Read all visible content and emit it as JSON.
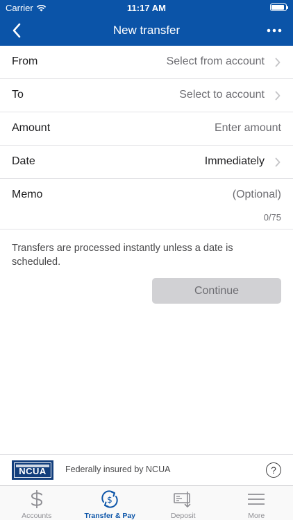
{
  "status_bar": {
    "carrier": "Carrier",
    "time": "11:17 AM",
    "battery_level": 0.9
  },
  "nav": {
    "title": "New transfer",
    "back_icon": "chevron-left-icon",
    "more_icon": "ellipsis-icon"
  },
  "form": {
    "from": {
      "label": "From",
      "value": "Select from account"
    },
    "to": {
      "label": "To",
      "value": "Select to account"
    },
    "amount": {
      "label": "Amount",
      "placeholder": "Enter amount"
    },
    "date": {
      "label": "Date",
      "value": "Immediately"
    },
    "memo": {
      "label": "Memo",
      "placeholder": "(Optional)",
      "counter": "0/75"
    }
  },
  "info_text": "Transfers are processed instantly unless a date is scheduled.",
  "continue_label": "Continue",
  "footer": {
    "logo_text": "NCUA",
    "insured_text": "Federally insured by NCUA",
    "help_label": "?"
  },
  "tabs": [
    {
      "label": "Accounts",
      "icon": "dollar-icon",
      "active": false
    },
    {
      "label": "Transfer & Pay",
      "icon": "transfer-pay-icon",
      "active": true
    },
    {
      "label": "Deposit",
      "icon": "check-deposit-icon",
      "active": false
    },
    {
      "label": "More",
      "icon": "menu-icon",
      "active": false
    }
  ],
  "colors": {
    "brand": "#0b54a8",
    "disabled_button": "#d1d1d4",
    "ncua_blue": "#123e7c"
  }
}
